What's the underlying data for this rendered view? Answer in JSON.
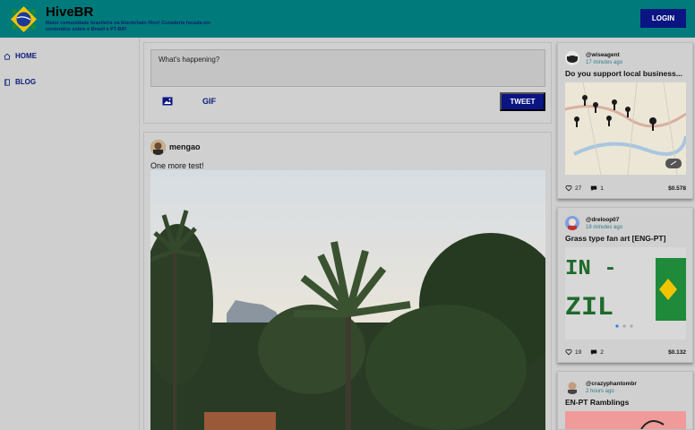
{
  "header": {
    "brand_title": "HiveBR",
    "brand_subtitle": "Maior comunidade brasileira na blockchain Hive! Curadoria focada em conteúdos sobre o Brasil e PT-BR!",
    "login_label": "LOGIN"
  },
  "sidebar": {
    "items": [
      {
        "label": "HOME",
        "icon": "home-icon"
      },
      {
        "label": "BLOG",
        "icon": "book-icon"
      }
    ]
  },
  "composer": {
    "placeholder": "What's happening?",
    "gif_label": "GIF",
    "tweet_label": "TWEET"
  },
  "post": {
    "author": "mengao",
    "text": "One more test!"
  },
  "cards": [
    {
      "author": "@wiseagent",
      "time": "17 minutes ago",
      "title": "Do you support local business...",
      "likes": "27",
      "comments": "1",
      "payout": "$0.578"
    },
    {
      "author": "@dreloop07",
      "time": "18 minutes ago",
      "title": "Grass type fan art [ENG-PT]",
      "likes": "19",
      "comments": "2",
      "payout": "$0.132"
    },
    {
      "author": "@crazyphantombr",
      "time": "2 hours ago",
      "title": "EN-PT Ramblings"
    }
  ],
  "colors": {
    "header_bg": "#007a7a",
    "button_bg": "#0a1482",
    "page_bg": "#cfcfcf"
  }
}
